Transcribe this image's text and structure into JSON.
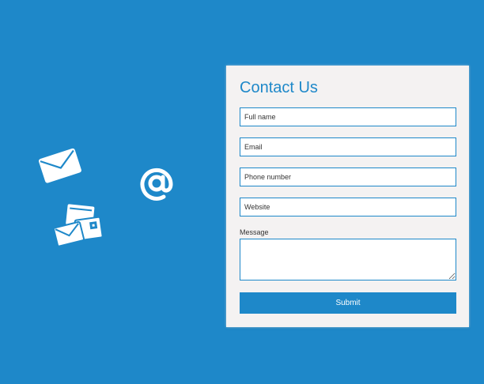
{
  "colors": {
    "background": "#1e88c9",
    "card": "#f4f2f2",
    "accent": "#1e88c9",
    "button_text": "#ffffff",
    "icon": "#ffffff"
  },
  "decorations": {
    "icons": [
      "envelope-icon",
      "at-sign-icon",
      "letters-icon"
    ]
  },
  "form": {
    "title": "Contact Us",
    "fields": {
      "full_name": {
        "placeholder": "Full name",
        "value": ""
      },
      "email": {
        "placeholder": "Email",
        "value": ""
      },
      "phone": {
        "placeholder": "Phone number",
        "value": ""
      },
      "website": {
        "placeholder": "Website",
        "value": ""
      }
    },
    "message_label": "Message",
    "message_value": "",
    "submit_label": "Submit"
  }
}
